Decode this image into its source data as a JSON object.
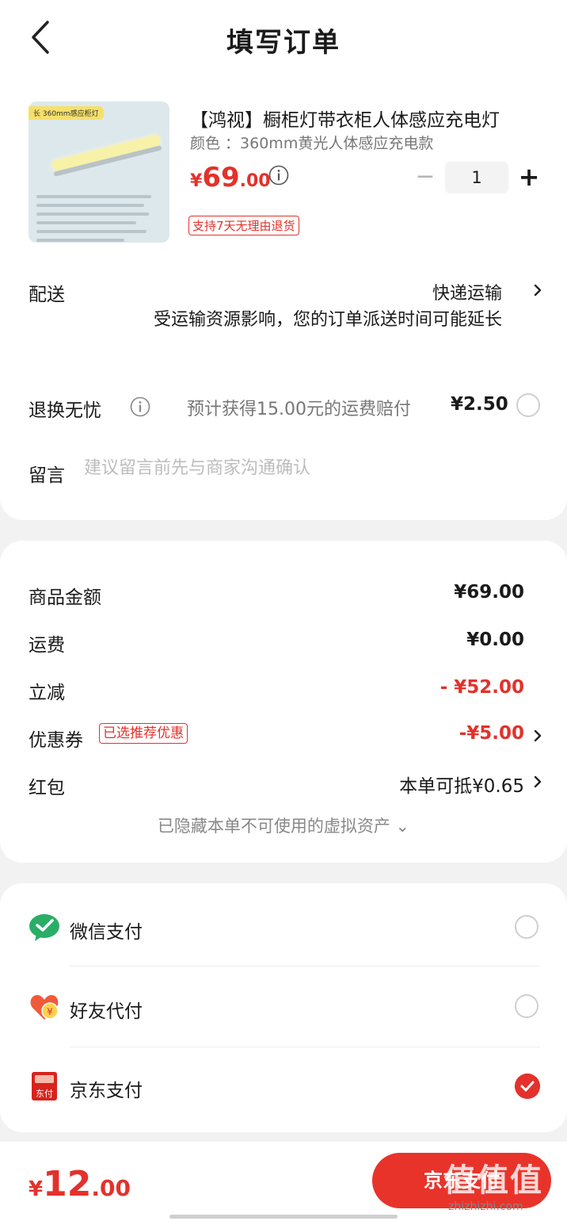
{
  "header": {
    "title": "填写订单"
  },
  "product": {
    "image_tag": "长 360mm感应柜灯",
    "title": "【鸿视】橱柜灯带衣柜人体感应充电灯",
    "spec": "颜色 ：360mm黄光人体感应充电款",
    "price_currency": "¥",
    "price_int": "69",
    "price_dec": ".00",
    "quantity": "1",
    "minus": "−",
    "plus": "+",
    "return_badge": "支持7天无理由退货"
  },
  "delivery": {
    "label": "配送",
    "value": "快递运输",
    "note": "受运输资源影响，您的订单派送时间可能延长"
  },
  "return_insurance": {
    "label": "退换无忧",
    "text": "预计获得15.00元的运费赔付",
    "price": "¥2.50"
  },
  "message": {
    "label": "留言",
    "placeholder": "建议留言前先与商家沟通确认"
  },
  "summary": {
    "goods_label": "商品金额",
    "goods_value": "¥69.00",
    "shipping_label": "运费",
    "shipping_value": "¥0.00",
    "discount_label": "立减",
    "discount_value": "- ¥52.00",
    "coupon_label": "优惠券",
    "coupon_badge": "已选推荐优惠",
    "coupon_value": "-¥5.00",
    "redpacket_label": "红包",
    "redpacket_value": "本单可抵¥0.65",
    "hidden_assets": "已隐藏本单不可使用的虚拟资产 ⌄"
  },
  "payment": {
    "methods": [
      {
        "label": "微信支付",
        "selected": false
      },
      {
        "label": "好友代付",
        "selected": false
      },
      {
        "label": "京东支付",
        "selected": true
      }
    ],
    "jd_icon_text": "东付",
    "friend_icon_text": "¥"
  },
  "bottom": {
    "total_currency": "¥",
    "total_int": "12",
    "total_dec": ".00",
    "pay_button": "京东支付",
    "watermark": "值值值",
    "watermark_sub": "zhizhizhi.com"
  },
  "colors": {
    "accent": "#e4312b",
    "wechat": "#2aae67"
  }
}
